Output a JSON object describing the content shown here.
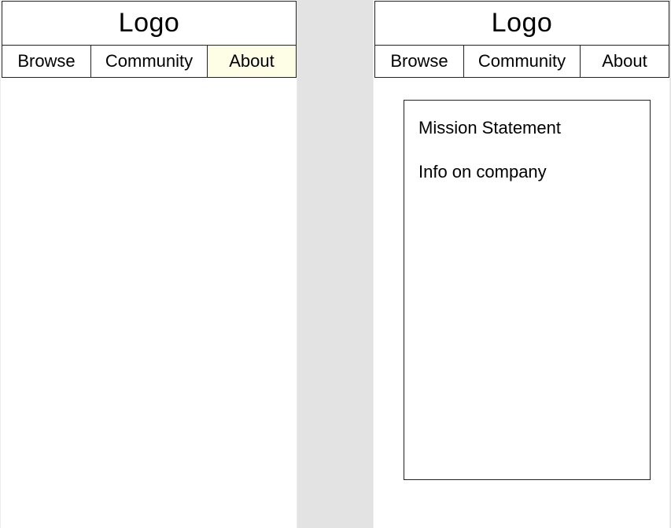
{
  "screens": [
    {
      "logo": "Logo",
      "nav": {
        "browse": "Browse",
        "community": "Community",
        "about": "About"
      },
      "active_tab": "about",
      "highlight_color": "#fefde6"
    },
    {
      "logo": "Logo",
      "nav": {
        "browse": "Browse",
        "community": "Community",
        "about": "About"
      },
      "content": {
        "mission": "Mission Statement",
        "info": "Info on company"
      }
    }
  ],
  "colors": {
    "background_gap": "#e3e3e3",
    "screen": "#ffffff",
    "border": "#222222"
  }
}
